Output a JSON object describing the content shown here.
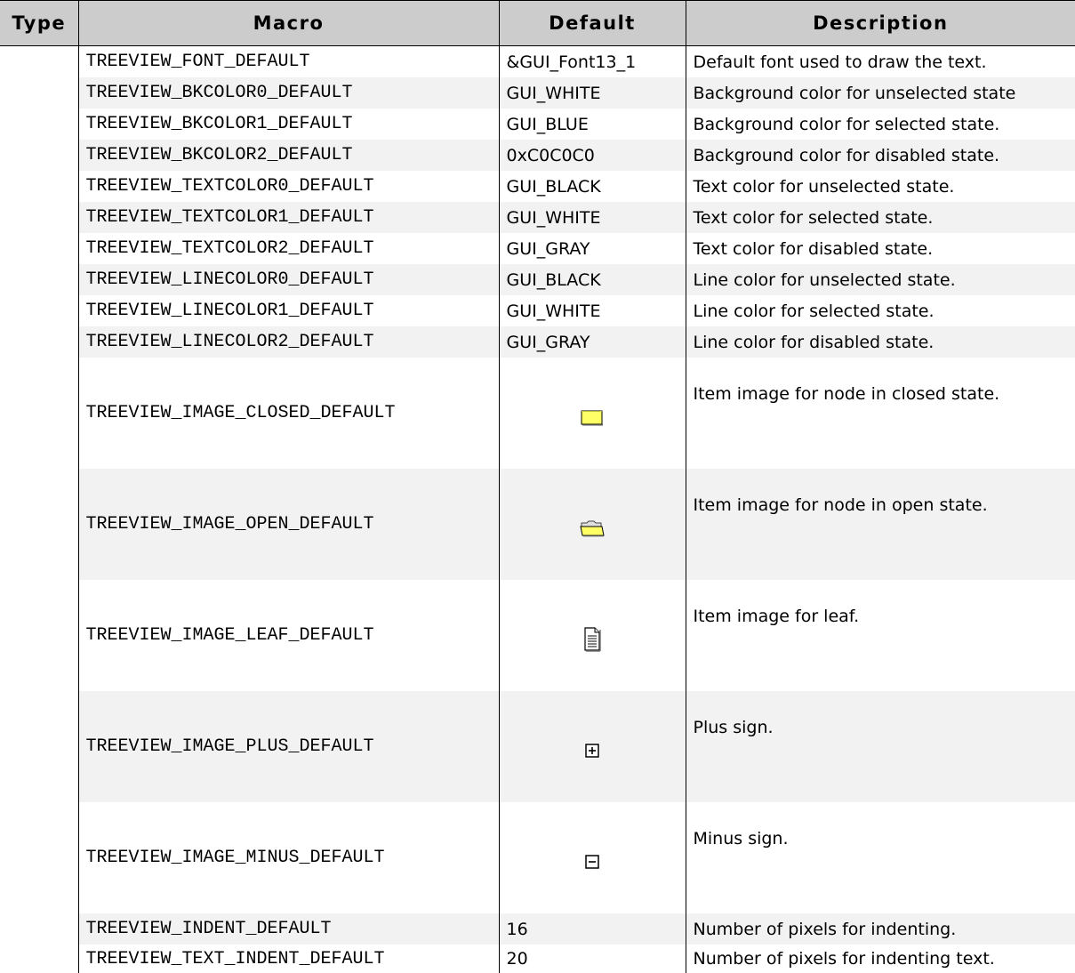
{
  "table": {
    "headers": [
      "Type",
      "Macro",
      "Default",
      "Description"
    ],
    "rows": [
      {
        "type": "",
        "macro": "TREEVIEW_FONT_DEFAULT",
        "default": "&GUI_Font13_1",
        "description": "Default font used to draw the text."
      },
      {
        "type": "",
        "macro": "TREEVIEW_BKCOLOR0_DEFAULT",
        "default": "GUI_WHITE",
        "description": "Background color for unselected state"
      },
      {
        "type": "",
        "macro": "TREEVIEW_BKCOLOR1_DEFAULT",
        "default": "GUI_BLUE",
        "description": "Background color for selected state."
      },
      {
        "type": "",
        "macro": "TREEVIEW_BKCOLOR2_DEFAULT",
        "default": "0xC0C0C0",
        "description": "Background color for disabled state."
      },
      {
        "type": "",
        "macro": "TREEVIEW_TEXTCOLOR0_DEFAULT",
        "default": "GUI_BLACK",
        "description": "Text color for unselected state."
      },
      {
        "type": "",
        "macro": "TREEVIEW_TEXTCOLOR1_DEFAULT",
        "default": "GUI_WHITE",
        "description": "Text color for selected state."
      },
      {
        "type": "",
        "macro": "TREEVIEW_TEXTCOLOR2_DEFAULT",
        "default": "GUI_GRAY",
        "description": "Text color for disabled state."
      },
      {
        "type": "",
        "macro": "TREEVIEW_LINECOLOR0_DEFAULT",
        "default": "GUI_BLACK",
        "description": "Line color for unselected state."
      },
      {
        "type": "",
        "macro": "TREEVIEW_LINECOLOR1_DEFAULT",
        "default": "GUI_WHITE",
        "description": "Line color for selected state."
      },
      {
        "type": "",
        "macro": "TREEVIEW_LINECOLOR2_DEFAULT",
        "default": "GUI_GRAY",
        "description": "Line color for disabled state."
      },
      {
        "type": "",
        "macro": "TREEVIEW_IMAGE_CLOSED_DEFAULT",
        "default_icon": "closed-folder-icon",
        "description": "Item image for node in closed state."
      },
      {
        "type": "",
        "macro": "TREEVIEW_IMAGE_OPEN_DEFAULT",
        "default_icon": "open-folder-icon",
        "description": "Item image for node in open state."
      },
      {
        "type": "",
        "macro": "TREEVIEW_IMAGE_LEAF_DEFAULT",
        "default_icon": "leaf-document-icon",
        "description": "Item image for leaf."
      },
      {
        "type": "",
        "macro": "TREEVIEW_IMAGE_PLUS_DEFAULT",
        "default_icon": "plus-sign-icon",
        "description": "Plus sign."
      },
      {
        "type": "",
        "macro": "TREEVIEW_IMAGE_MINUS_DEFAULT",
        "default_icon": "minus-sign-icon",
        "description": "Minus sign."
      },
      {
        "type": "",
        "macro": "TREEVIEW_INDENT_DEFAULT",
        "default": "16",
        "description": "Number of pixels for indenting."
      },
      {
        "type": "",
        "macro": "TREEVIEW_TEXT_INDENT_DEFAULT",
        "default": "20",
        "description": "Number of pixels for indenting text."
      }
    ]
  },
  "colors": {
    "header_bg": "#cccccc",
    "alt_row_bg": "#f2f2f2",
    "folder_yellow": "#ffff66"
  }
}
